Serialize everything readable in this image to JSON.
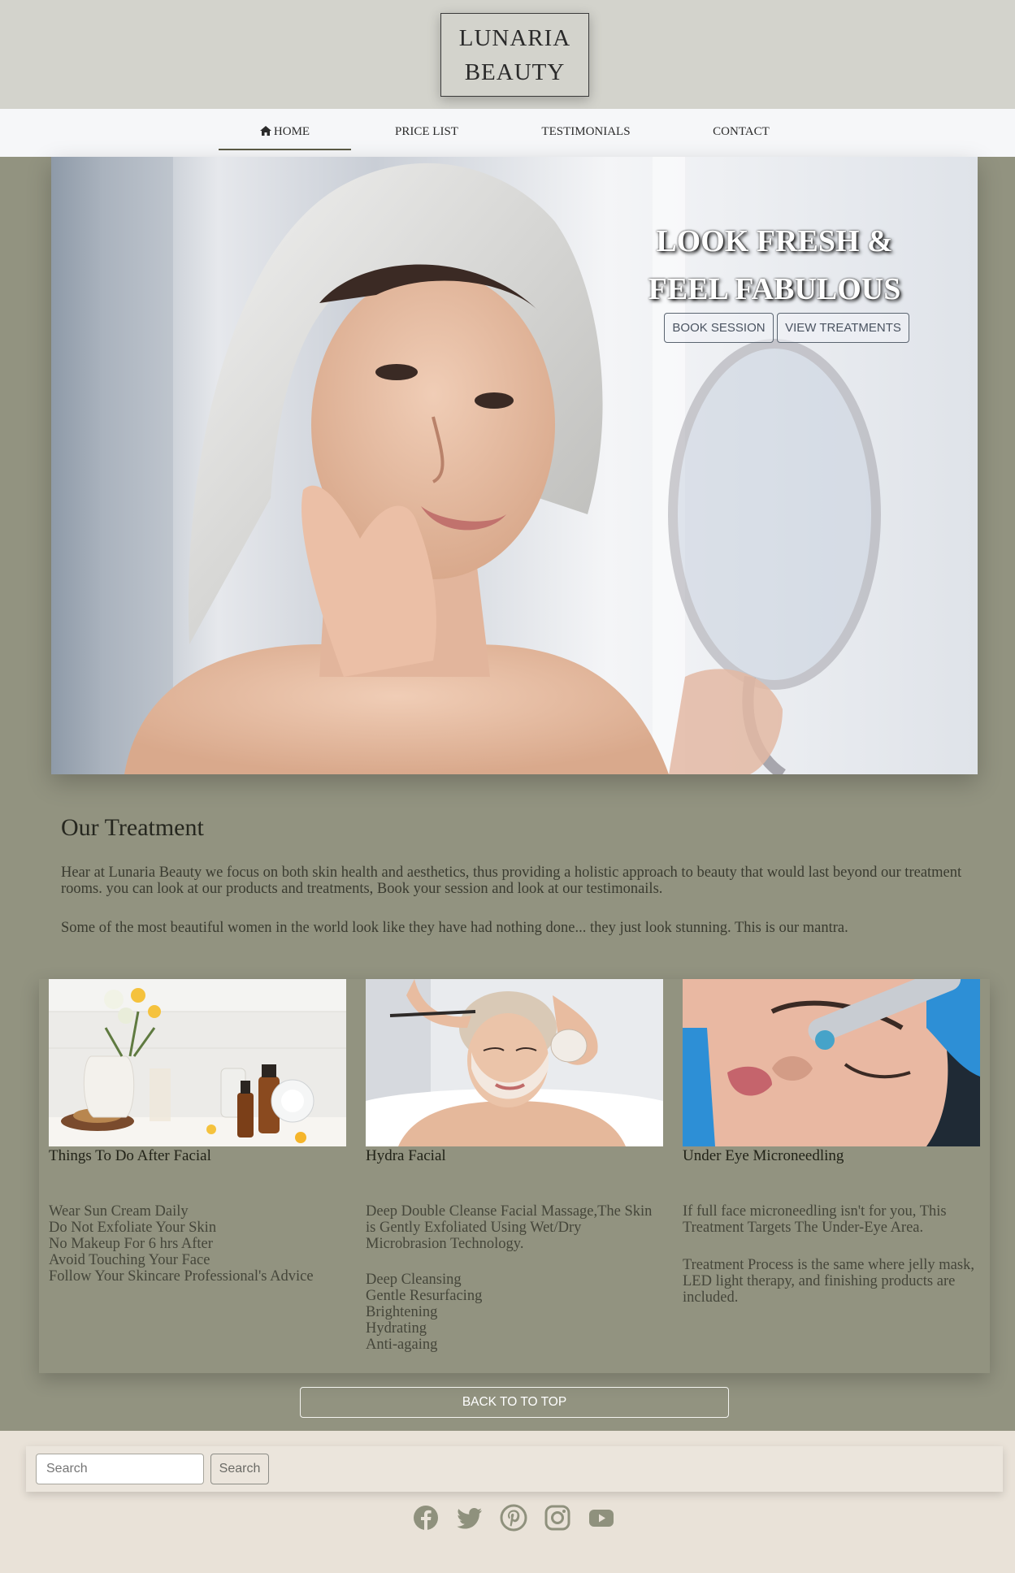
{
  "brand": {
    "line1": "LUNARIA",
    "line2": "BEAUTY"
  },
  "nav": {
    "items": [
      {
        "label": "HOME",
        "icon": "home-icon",
        "active": true
      },
      {
        "label": "PRICE LIST"
      },
      {
        "label": "TESTIMONIALS"
      },
      {
        "label": "CONTACT"
      }
    ]
  },
  "hero": {
    "title_line1": "LOOK FRESH &",
    "title_line2": "FEEL FABULOUS",
    "book_label": "BOOK SESSION",
    "view_label": "VIEW TREATMENTS"
  },
  "treatment": {
    "title": "Our Treatment",
    "para1": "Hear at Lunaria Beauty we focus on both skin health and aesthetics, thus providing a holistic approach to beauty that would last beyond our treatment rooms. you can look at our products and treatments, Book your session and look at our testimonails.",
    "para2": "Some of the most beautiful women in the world look like they have had nothing done... they just look stunning. This is our mantra."
  },
  "cards": [
    {
      "title": "Things To Do After Facial",
      "lines": [
        "Wear Sun Cream Daily",
        "Do Not Exfoliate Your Skin",
        "No Makeup For 6 hrs After",
        "Avoid Touching Your Face",
        "Follow Your Skincare Professional's Advice"
      ]
    },
    {
      "title": "Hydra Facial",
      "para": "Deep Double Cleanse Facial Massage,The Skin is Gently Exfoliated Using Wet/Dry Microbrasion Technology.",
      "lines": [
        "Deep Cleansing",
        "Gentle Resurfacing",
        "Brightening",
        "Hydrating",
        "Anti-againg"
      ]
    },
    {
      "title": "Under Eye Microneedling",
      "para": "If full face microneedling isn't for you, This Treatment Targets The Under-Eye Area.",
      "para2": "Treatment Process is the same where jelly mask, LED light therapy, and finishing products are included."
    }
  ],
  "back_to_top": "BACK TO TO TOP",
  "footer": {
    "search_placeholder": "Search",
    "search_button": "Search",
    "social": [
      "facebook-icon",
      "twitter-icon",
      "pinterest-icon",
      "instagram-icon",
      "youtube-icon"
    ]
  },
  "colors": {
    "page_bg": "#929380",
    "header_bg": "#d3d3cc",
    "nav_bg": "#f6f7f9",
    "footer_bg": "#e9e2d8",
    "social_icon": "#8f917d"
  }
}
